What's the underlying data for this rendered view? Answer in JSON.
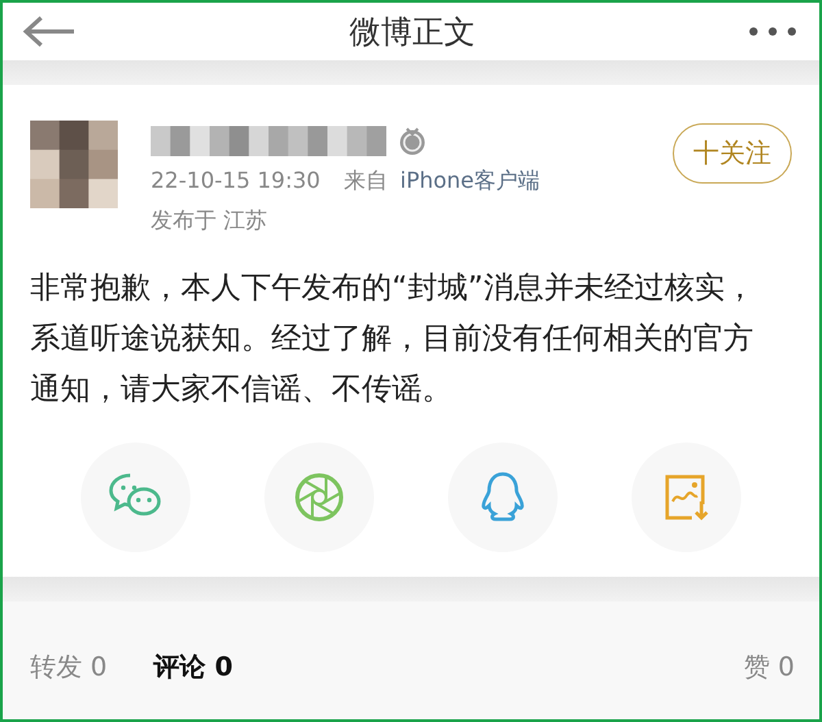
{
  "header": {
    "title": "微博正文"
  },
  "post": {
    "timestamp": "22-10-15 19:30",
    "source_prefix": "来自",
    "source": "iPhone客户端",
    "location": "发布于 江苏",
    "follow_label": "十关注",
    "text": "非常抱歉，本人下午发布的“封城”消息并未经过核实，系道听途说获知。经过了解，目前没有任何相关的官方通知，请大家不信谣、不传谣。"
  },
  "tabs": [
    {
      "label": "转发 0",
      "selected": false
    },
    {
      "label": "评论 0",
      "selected": true
    },
    {
      "label": "赞 0",
      "selected": false
    }
  ]
}
